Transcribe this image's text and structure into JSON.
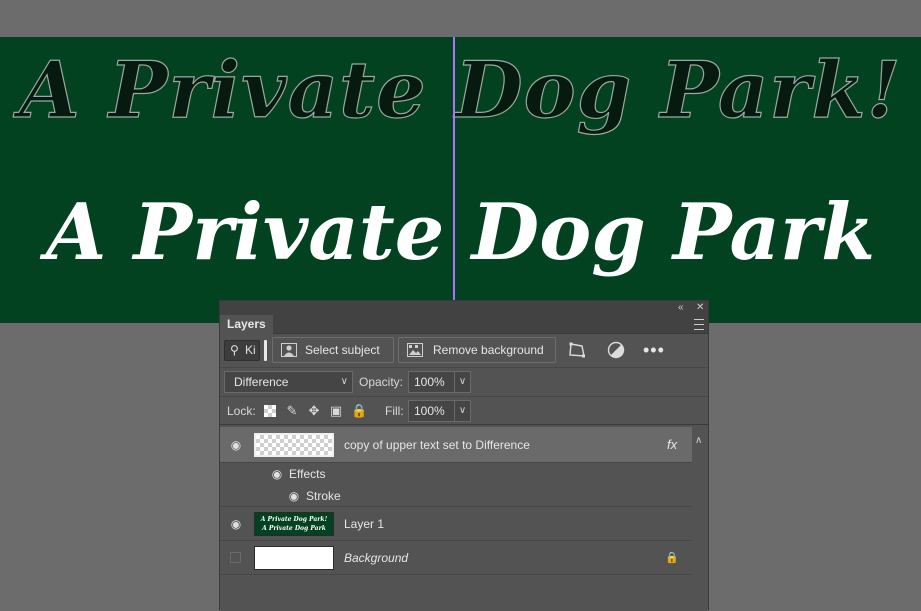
{
  "canvas": {
    "upper_text": "A Private Dog Park!",
    "lower_text": "A Private Dog Park",
    "background_color": "#024220",
    "guide_color": "#b070ff"
  },
  "panel": {
    "title": "Layers",
    "collapse_icon": "double-chevron-left-icon",
    "close_icon": "close-icon",
    "menu_icon": "panel-menu-icon"
  },
  "toolbar": {
    "search_value": "Ki",
    "select_subject_label": "Select subject",
    "remove_background_label": "Remove background"
  },
  "blend": {
    "mode": "Difference",
    "opacity_label": "Opacity:",
    "opacity_value": "100%"
  },
  "lock": {
    "label": "Lock:",
    "fill_label": "Fill:",
    "fill_value": "100%"
  },
  "layers": [
    {
      "name": "copy of upper text set to Difference",
      "visible": true,
      "selected": true,
      "fx": "fx",
      "effects_label": "Effects",
      "effect_items": [
        "Stroke"
      ]
    },
    {
      "name": "Layer 1",
      "visible": true,
      "thumb_line1": "A Private Dog Park!",
      "thumb_line2": "A Private Dog Park"
    },
    {
      "name": "Background",
      "visible": false,
      "locked": true
    }
  ]
}
